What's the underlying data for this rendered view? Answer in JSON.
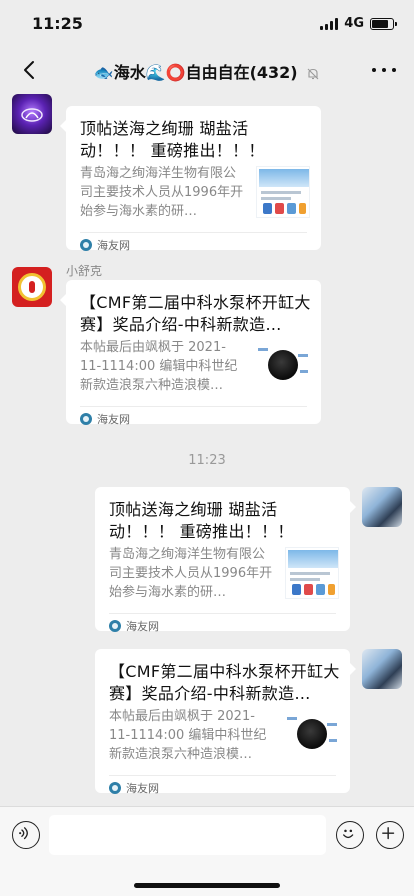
{
  "status": {
    "time": "11:25",
    "network": "4G",
    "battery_level": 0.8
  },
  "header": {
    "title": "🐟海水🌊⭕自由自在(432)",
    "back_icon": "chevron-left-icon",
    "mute_icon": "bell-off-icon",
    "more_icon": "ellipsis-icon"
  },
  "messages": [
    {
      "side": "left",
      "sender": "",
      "title": "顶帖送海之绚珊 瑚盐活动！！！ 重磅推出！！！",
      "description": "青岛海之绚海洋生物有限公司主要技术人员从1996年开始参与海水素的研…",
      "source": "海友网"
    },
    {
      "side": "left",
      "sender": "小舒克",
      "title": "【CMF第二届中科水泵杯开缸大赛】奖品介绍-中科新款造…",
      "description": "本帖最后由飒枫于 2021-11-1114:00 编辑中科世纪新款造浪泵六种造浪模…",
      "source": "海友网"
    },
    {
      "side": "right",
      "sender": "",
      "title": "顶帖送海之绚珊 瑚盐活动！！！ 重磅推出！！！",
      "description": "青岛海之绚海洋生物有限公司主要技术人员从1996年开始参与海水素的研…",
      "source": "海友网"
    },
    {
      "side": "right",
      "sender": "",
      "title": "【CMF第二届中科水泵杯开缸大赛】奖品介绍-中科新款造…",
      "description": "本帖最后由飒枫于 2021-11-1114:00 编辑中科世纪新款造浪泵六种造浪模…",
      "source": "海友网"
    }
  ],
  "timestamp": "11:23",
  "input": {
    "value": "",
    "placeholder": ""
  },
  "colors": {
    "background": "#ededed",
    "card": "#ffffff",
    "secondary_text": "#888888"
  }
}
